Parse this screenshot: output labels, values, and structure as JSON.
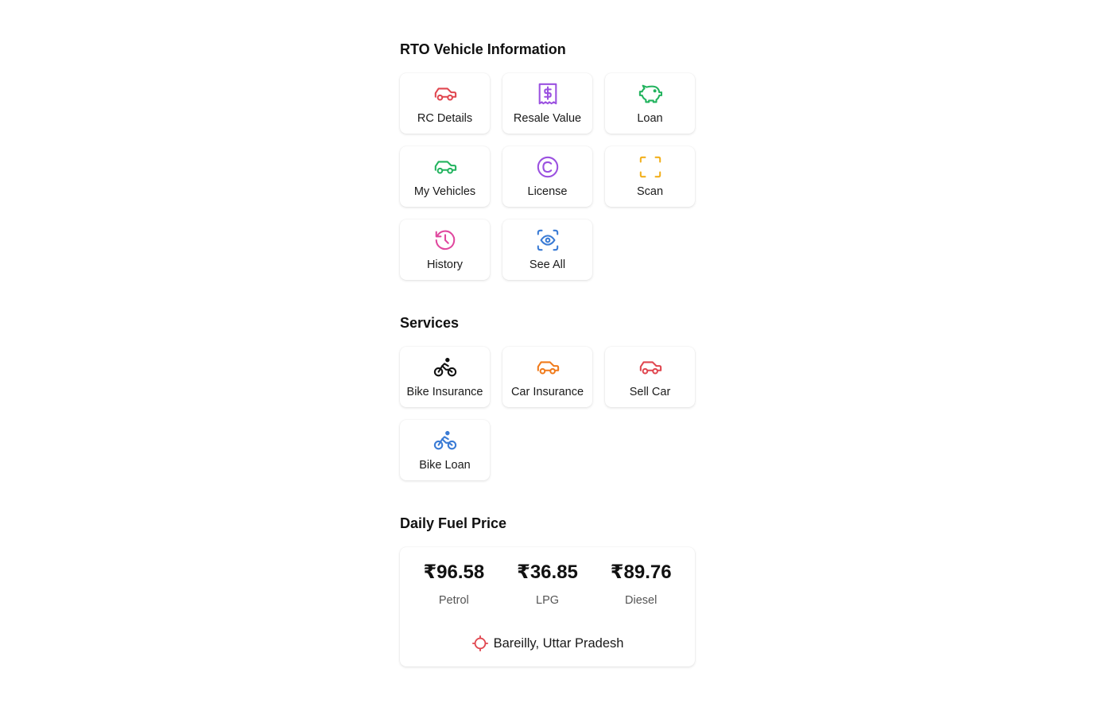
{
  "rto": {
    "title": "RTO Vehicle Information",
    "items": [
      {
        "label": "RC Details",
        "icon": "car-icon",
        "color": "#e0464f"
      },
      {
        "label": "Resale Value",
        "icon": "receipt-dollar-icon",
        "color": "#9b51e0"
      },
      {
        "label": "Loan",
        "icon": "piggy-bank-icon",
        "color": "#22b35e"
      },
      {
        "label": "My Vehicles",
        "icon": "car-icon",
        "color": "#22b35e"
      },
      {
        "label": "License",
        "icon": "copyright-icon",
        "color": "#9b51e0"
      },
      {
        "label": "Scan",
        "icon": "scan-icon",
        "color": "#f2b01e"
      },
      {
        "label": "History",
        "icon": "history-icon",
        "color": "#e0479e"
      },
      {
        "label": "See All",
        "icon": "eye-icon",
        "color": "#3a7bd5"
      }
    ]
  },
  "services": {
    "title": "Services",
    "items": [
      {
        "label": "Bike Insurance",
        "icon": "bike-icon",
        "color": "#111111"
      },
      {
        "label": "Car Insurance",
        "icon": "car-icon",
        "color": "#f07a1a"
      },
      {
        "label": "Sell Car",
        "icon": "car-icon",
        "color": "#e0464f"
      },
      {
        "label": "Bike Loan",
        "icon": "bike-icon",
        "color": "#3a7bd5"
      }
    ]
  },
  "fuel": {
    "title": "Daily Fuel Price",
    "prices": [
      {
        "value": "₹96.58",
        "name": "Petrol"
      },
      {
        "value": "₹36.85",
        "name": "LPG"
      },
      {
        "value": "₹89.76",
        "name": "Diesel"
      }
    ],
    "location": "Bareilly, Uttar Pradesh",
    "location_icon": "crosshair-icon",
    "location_color": "#e0464f"
  }
}
